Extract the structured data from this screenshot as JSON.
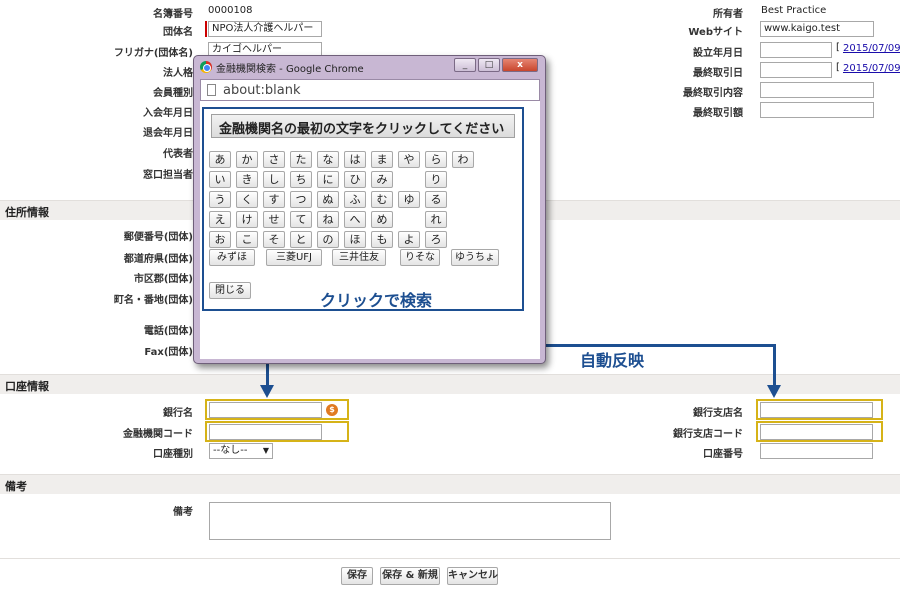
{
  "top_form": {
    "meibo_label": "名簿番号",
    "meibo_value": "0000108",
    "dantai_label": "団体名",
    "dantai_value": "NPO法人介護ヘルパー",
    "furigana_label": "フリガナ(団体名)",
    "furigana_value": "カイゴヘルパー",
    "houjin_label": "法人格",
    "kaiin_label": "会員種別",
    "nyukai_label": "入会年月日",
    "taikai_label": "退会年月日",
    "daihyo_label": "代表者",
    "madoguchi_label": "窓口担当者",
    "owner_label": "所有者",
    "owner_value": "Best Practice",
    "website_label": "Webサイト",
    "website_value": "www.kaigo.test",
    "setsuritsu_label": "設立年月日",
    "setsuritsu_date": "2015/07/09",
    "saishu_label": "最終取引日",
    "saishu_date": "2015/07/09",
    "saishu_naiyo_label": "最終取引内容",
    "saishu_gaku_label": "最終取引額",
    "bracket": "["
  },
  "address_section": {
    "title": "住所情報",
    "yubin_label": "郵便番号(団体)",
    "todofuken_label": "都道府県(団体)",
    "shiku_label": "市区郡(団体)",
    "cho_label": "町名・番地(団体)",
    "denwa_label": "電話(団体)",
    "fax_label": "Fax(団体)"
  },
  "account_section": {
    "title": "口座情報",
    "ginko_label": "銀行名",
    "kikan_code_label": "金融機関コード",
    "koza_shubetsu_label": "口座種別",
    "koza_shubetsu_value": "--なし--",
    "shiten_label": "銀行支店名",
    "shiten_code_label": "銀行支店コード",
    "koza_bango_label": "口座番号",
    "dollar_icon": "$"
  },
  "notes_section": {
    "title": "備考",
    "biko_label": "備考"
  },
  "buttons": {
    "save": "保存",
    "save_new": "保存 & 新規",
    "cancel": "キャンセル"
  },
  "popup": {
    "title": "金融機関検索 - Google Chrome",
    "min": "_",
    "max": "□",
    "close": "x",
    "address": "about:blank",
    "instruction": "金融機関名の最初の文字をクリックしてください",
    "kana_rows": [
      [
        "あ",
        "か",
        "さ",
        "た",
        "な",
        "は",
        "ま",
        "や",
        "ら",
        "わ"
      ],
      [
        "い",
        "き",
        "し",
        "ち",
        "に",
        "ひ",
        "み",
        "",
        "り",
        ""
      ],
      [
        "う",
        "く",
        "す",
        "つ",
        "ぬ",
        "ふ",
        "む",
        "ゆ",
        "る",
        ""
      ],
      [
        "え",
        "け",
        "せ",
        "て",
        "ね",
        "へ",
        "め",
        "",
        "れ",
        ""
      ],
      [
        "お",
        "こ",
        "そ",
        "と",
        "の",
        "ほ",
        "も",
        "よ",
        "ろ",
        ""
      ]
    ],
    "banks": [
      "みずほ",
      "三菱UFJ",
      "三井住友",
      "りそな",
      "ゆうちょ"
    ],
    "close_button": "閉じる"
  },
  "annotations": {
    "click_search": "クリックで検索",
    "auto_reflect": "自動反映"
  },
  "colors": {
    "annotation_blue": "#1d4f91",
    "highlight_yellow": "#d6b318",
    "section_bg": "#f0eeec",
    "popup_frame": "#c8b7d3"
  }
}
